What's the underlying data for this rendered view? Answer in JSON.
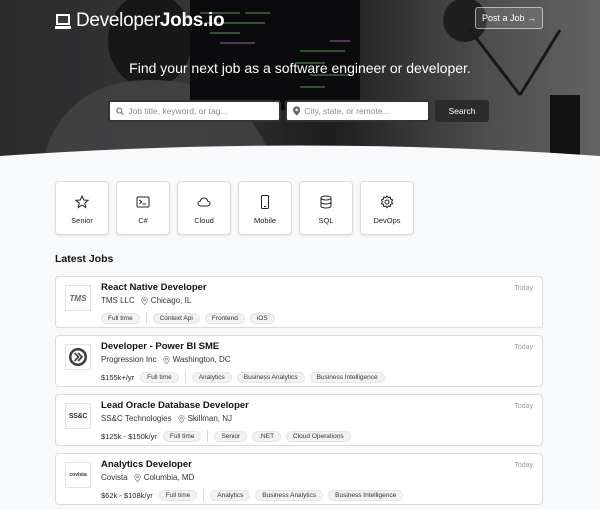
{
  "header": {
    "logo_part1": "Developer",
    "logo_part2": "Jobs.io",
    "post_button": "Post a Job →"
  },
  "hero": {
    "tagline": "Find your next job as a software engineer or developer.",
    "search_placeholder": "Job title, keyword, or tag...",
    "location_placeholder": "City, state, or remote...",
    "search_button": "Search"
  },
  "categories": [
    {
      "label": "Senior",
      "icon": "star-icon"
    },
    {
      "label": "C#",
      "icon": "terminal-icon"
    },
    {
      "label": "Cloud",
      "icon": "cloud-icon"
    },
    {
      "label": "Mobile",
      "icon": "mobile-icon"
    },
    {
      "label": "SQL",
      "icon": "database-icon"
    },
    {
      "label": "DevOps",
      "icon": "gear-icon"
    }
  ],
  "section_title": "Latest Jobs",
  "jobs": [
    {
      "title": "React Native Developer",
      "company": "TMS LLC",
      "location": "Chicago, IL",
      "time": "Today",
      "salary": "",
      "type": "Full time",
      "tags": [
        "Context Api",
        "Frontend",
        "iOS"
      ],
      "logo": "TMS"
    },
    {
      "title": "Developer - Power BI SME",
      "company": "Progression Inc",
      "location": "Washington, DC",
      "time": "Today",
      "salary": "$155k+/yr",
      "type": "Full time",
      "tags": [
        "Analytics",
        "Business Analytics",
        "Business Intelligence"
      ],
      "logo": ""
    },
    {
      "title": "Lead Oracle Database Developer",
      "company": "SS&C Technologies",
      "location": "Skillman, NJ",
      "time": "Today",
      "salary": "$125k - $150k/yr",
      "type": "Full time",
      "tags": [
        "Senior",
        ".NET",
        "Cloud Operations"
      ],
      "logo": "SS&C"
    },
    {
      "title": "Analytics Developer",
      "company": "Covista",
      "location": "Columbia, MD",
      "time": "Today",
      "salary": "$62k - $108k/yr",
      "type": "Full time",
      "tags": [
        "Analytics",
        "Business Analytics",
        "Business Intelligence"
      ],
      "logo": "covista"
    }
  ],
  "colors": {
    "dark": "#2b2b2b",
    "tag_bg": "#f1f2f3",
    "page_bg": "#f8f9fa"
  }
}
